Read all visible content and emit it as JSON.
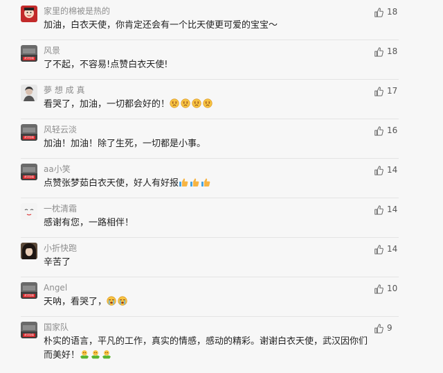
{
  "comments": [
    {
      "username": "家里的棉被是热的",
      "text": "加油，白衣天使，你肯定还会有一个比天使更可爱的宝宝～",
      "likes": "18",
      "avatar": "avatar-red-cartoon"
    },
    {
      "username": "风景",
      "text": "了不起，不容易!点赞白衣天使!",
      "likes": "18",
      "avatar": "avatar-wuhan-badge",
      "badge_text": "武汉加油"
    },
    {
      "username": "夢 想 成 真",
      "text": "看哭了，加油，一切都会好的！",
      "likes": "17",
      "avatar": "avatar-photo",
      "emoji": [
        "sad-face",
        "sad-face",
        "sad-face",
        "sad-face"
      ]
    },
    {
      "username": "风轻云淡",
      "text": "加油！加油！除了生死，一切都是小事。",
      "likes": "16",
      "avatar": "avatar-wuhan-badge",
      "badge_text": "武汉加油"
    },
    {
      "username": "aa小笑",
      "text": "点赞张梦茹白衣天使，好人有好报",
      "likes": "14",
      "avatar": "avatar-wuhan-badge",
      "badge_text": "武汉加油",
      "emoji": [
        "thumbs-up",
        "thumbs-up",
        "thumbs-up"
      ]
    },
    {
      "username": "一枕清霜",
      "text": "感谢有您，一路相伴！",
      "likes": "14",
      "avatar": "avatar-sketch"
    },
    {
      "username": "小折快跑",
      "text": "辛苦了",
      "likes": "14",
      "avatar": "avatar-girl-dark-hair"
    },
    {
      "username": "Angel",
      "text": "天呐，看哭了，",
      "likes": "10",
      "avatar": "avatar-wuhan-badge",
      "badge_text": "武汉加油",
      "emoji": [
        "crying-face",
        "crying-face"
      ]
    },
    {
      "username": "国家队",
      "text": "朴实的语言，平凡的工作，真实的情感，感动的精彩。谢谢白衣天使，武汉因你们而美好！",
      "likes": "9",
      "avatar": "avatar-wuhan-badge",
      "badge_text": "武汉加油",
      "emoji": [
        "green-hands",
        "green-hands",
        "green-hands"
      ]
    }
  ]
}
